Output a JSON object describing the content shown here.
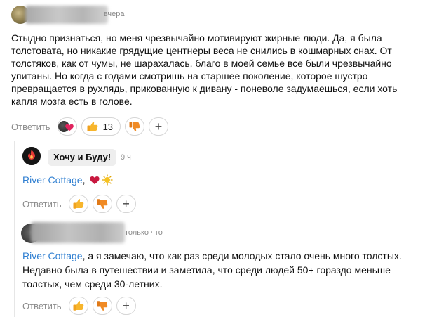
{
  "top_comment": {
    "time": "вчера",
    "text": "Стыдно признаться, но меня чрезвычайно мотивируют жирные люди. Да, я была толстовата, но никакие грядущие центнеры веса не снились в кошмарных снах. От толстяков, как от чумы, не шарахалась, благо в моей семье все были чрезвычайно упитаны. Но когда с годами смотришь на старшее поколение, которое шустро превращается в рухлядь, прикованную к дивану - поневоле задумаешься, если хоть капля мозга есть в голове.",
    "reply_label": "Ответить",
    "like_count": "13"
  },
  "reply_1": {
    "author": "Хочу и Буду!",
    "time": "9 ч",
    "mention": "River Cottage",
    "text_after_mention": ",",
    "reply_label": "Ответить"
  },
  "reply_2": {
    "time": "только что",
    "mention": "River Cottage",
    "text_after_mention": ", а я замечаю, что как раз среди молодых стало очень много толстых. Недавно была в путешествии и заметила, что среди людей 50+ гораздо меньше толстых, чем среди 30-летних.",
    "reply_label": "Ответить"
  },
  "icons": {
    "like": "thumbs-up-icon",
    "dislike": "thumbs-down-icon",
    "add_reaction": "plus-icon",
    "heart": "heart-icon",
    "sun": "sun-icon"
  },
  "colors": {
    "mention": "#2f7fd1",
    "muted": "#8c8c8c",
    "like_yellow": "#f7b52c",
    "dislike_orange": "#f08a24",
    "heart_red": "#e0245e"
  }
}
